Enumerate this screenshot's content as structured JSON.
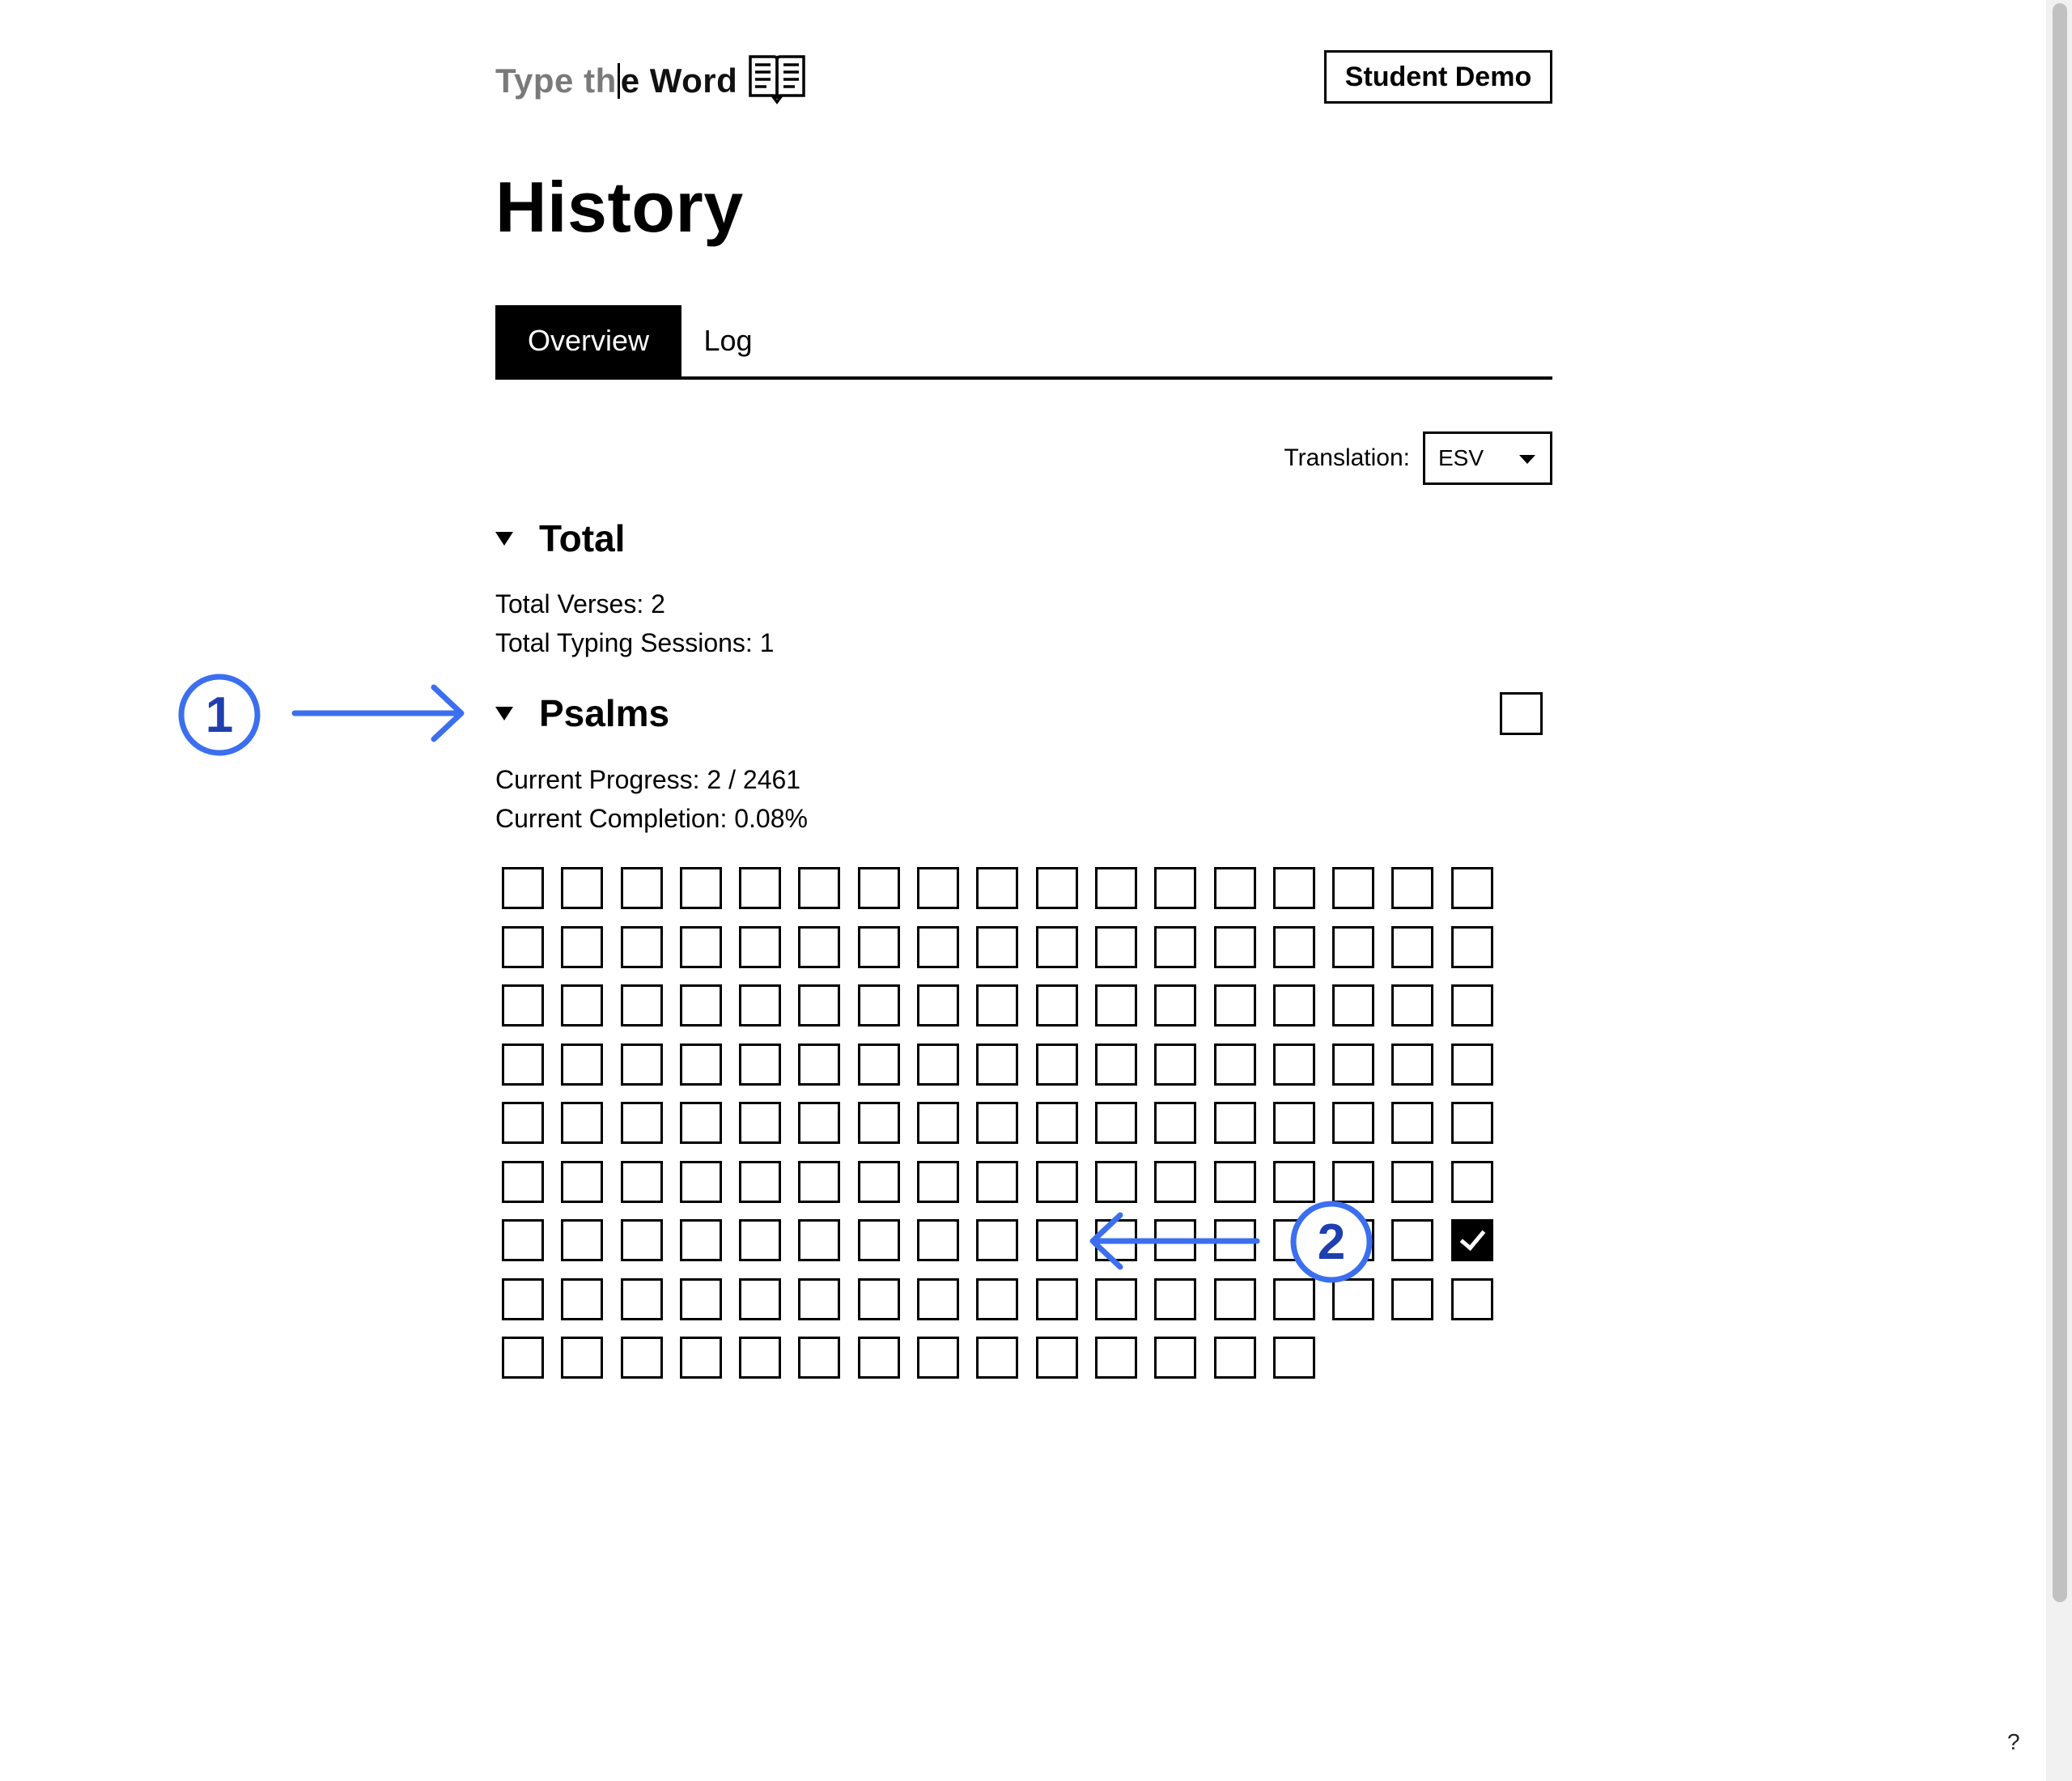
{
  "logo": {
    "part1": "Type th",
    "part2": "e Word",
    "icon": "open-book-icon"
  },
  "header": {
    "demo_button_label": "Student Demo"
  },
  "page_title": "History",
  "tabs": [
    {
      "label": "Overview",
      "active": true
    },
    {
      "label": "Log",
      "active": false
    }
  ],
  "translation": {
    "label": "Translation:",
    "selected": "ESV"
  },
  "total_section": {
    "title": "Total",
    "verses_text": "Total Verses: 2",
    "sessions_text": "Total Typing Sessions: 1"
  },
  "book_section": {
    "title": "Psalms",
    "progress_text": "Current Progress: 2 / 2461",
    "completion_text": "Current Completion: 0.08%",
    "chapter_count": 150,
    "completed_chapters": [
      119
    ]
  },
  "annotations": [
    {
      "number": "1",
      "color": "#3b6ff0"
    },
    {
      "number": "2",
      "color": "#3b6ff0"
    }
  ],
  "help_label": "?",
  "colors": {
    "accent": "#000000",
    "annotation": "#3b6ff0",
    "annotation_text": "#1f3fb0"
  }
}
